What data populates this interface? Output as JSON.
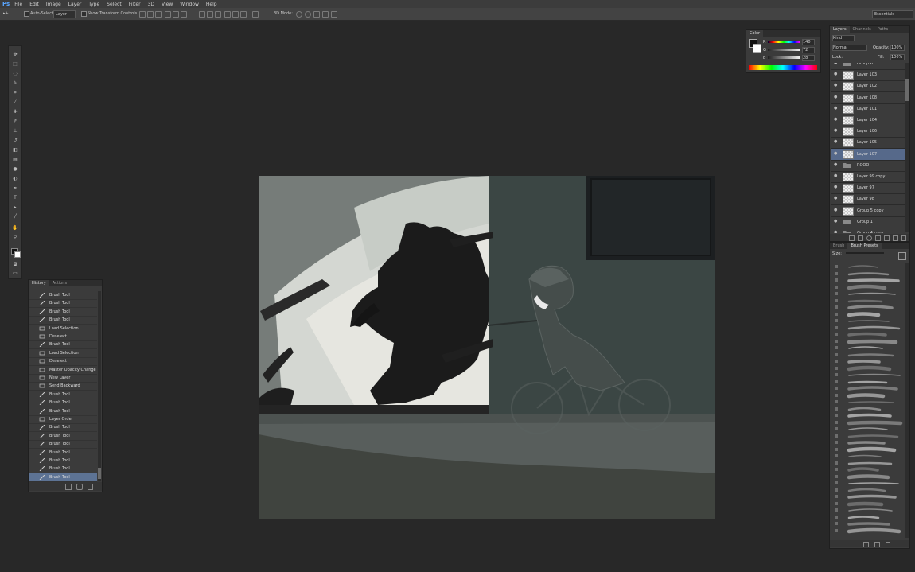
{
  "app": {
    "logo": "Ps"
  },
  "menu": [
    "File",
    "Edit",
    "Image",
    "Layer",
    "Type",
    "Select",
    "Filter",
    "3D",
    "View",
    "Window",
    "Help"
  ],
  "options": {
    "auto_select_label": "Auto-Select:",
    "auto_select_value": "Layer",
    "show_transform_label": "Show Transform Controls",
    "mode_3d_label": "3D Mode:",
    "workspace": "Essentials"
  },
  "color_panel": {
    "tab": "Color",
    "r": "140",
    "g": "72",
    "b": "28"
  },
  "history_panel": {
    "tabs": [
      "History",
      "Actions"
    ],
    "items": [
      "Brush Tool",
      "Brush Tool",
      "Brush Tool",
      "Brush Tool",
      "Load Selection",
      "Deselect",
      "Brush Tool",
      "Load Selection",
      "Deselect",
      "Master Opacity Change",
      "New Layer",
      "Send Backward",
      "Brush Tool",
      "Brush Tool",
      "Brush Tool",
      "Layer Order",
      "Brush Tool",
      "Brush Tool",
      "Brush Tool",
      "Brush Tool",
      "Brush Tool",
      "Brush Tool",
      "Brush Tool"
    ],
    "selected_index": 22
  },
  "layers_panel": {
    "tabs": [
      "Layers",
      "Channels",
      "Paths"
    ],
    "filter": "Kind",
    "blend_mode": "Normal",
    "opacity_label": "Opacity:",
    "opacity": "100%",
    "lock_label": "Lock:",
    "fill_label": "Fill:",
    "fill": "100%",
    "rows": [
      {
        "name": "Group 6",
        "type": "group"
      },
      {
        "name": "Layer 103",
        "type": "layer"
      },
      {
        "name": "Layer 102",
        "type": "layer"
      },
      {
        "name": "Layer 108",
        "type": "layer"
      },
      {
        "name": "Layer 101",
        "type": "layer"
      },
      {
        "name": "Layer 104",
        "type": "layer"
      },
      {
        "name": "Layer 106",
        "type": "layer"
      },
      {
        "name": "Layer 105",
        "type": "layer"
      },
      {
        "name": "Layer 107",
        "type": "layer"
      },
      {
        "name": "ROOO",
        "type": "group"
      },
      {
        "name": "Layer 99 copy",
        "type": "layer"
      },
      {
        "name": "Layer 97",
        "type": "layer"
      },
      {
        "name": "Layer 98",
        "type": "layer"
      },
      {
        "name": "Group 5 copy",
        "type": "layer"
      },
      {
        "name": "Group 1",
        "type": "group"
      },
      {
        "name": "Group 4 copy",
        "type": "group"
      }
    ],
    "selected_index": 8
  },
  "brush_panel": {
    "tabs": [
      "Brush",
      "Brush Presets"
    ],
    "size_label": "Size:"
  }
}
